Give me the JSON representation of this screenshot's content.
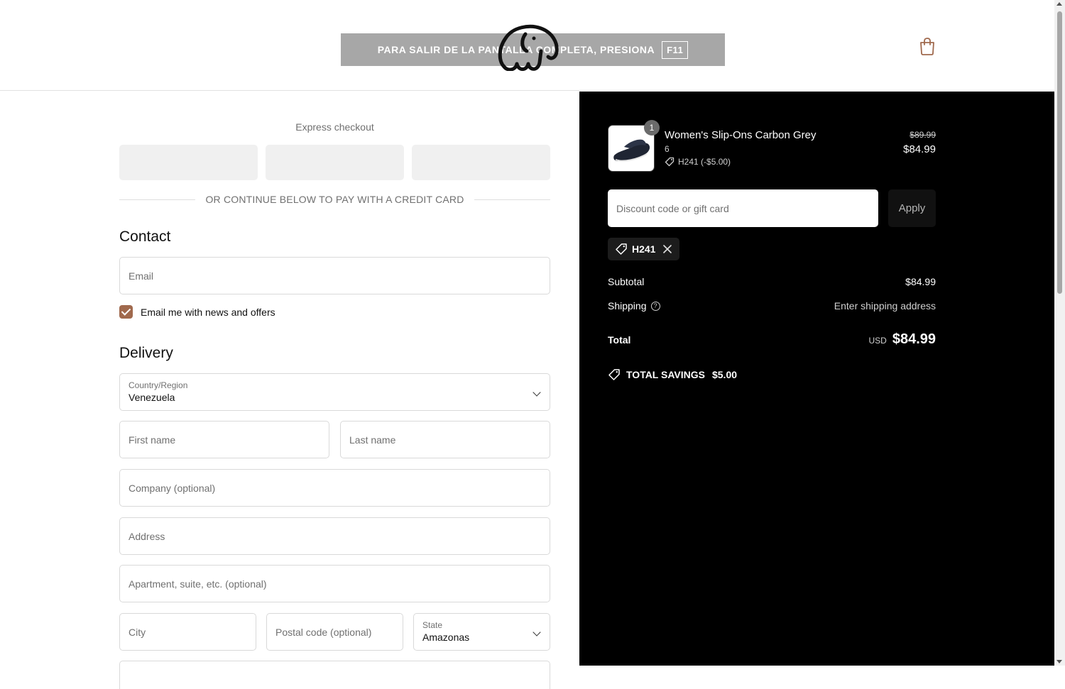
{
  "header": {
    "fullscreen_notice": "PARA SALIR DE LA PANTALLA COMPLETA, PRESIONA",
    "fullscreen_key": "F11",
    "logo_icon": "elephant-logo-icon",
    "cart_icon": "shopping-bag-icon"
  },
  "express": {
    "title": "Express checkout",
    "divider_text": "OR CONTINUE BELOW TO PAY WITH A CREDIT CARD"
  },
  "contact": {
    "title": "Contact",
    "email_placeholder": "Email",
    "newsletter_label": "Email me with news and offers",
    "newsletter_checked": true
  },
  "delivery": {
    "title": "Delivery",
    "country_label": "Country/Region",
    "country_value": "Venezuela",
    "first_name_placeholder": "First name",
    "last_name_placeholder": "Last name",
    "company_placeholder": "Company (optional)",
    "address_placeholder": "Address",
    "apartment_placeholder": "Apartment, suite, etc. (optional)",
    "city_placeholder": "City",
    "postal_placeholder": "Postal code (optional)",
    "state_label": "State",
    "state_value": "Amazonas"
  },
  "summary": {
    "product": {
      "quantity": "1",
      "name": "Women's Slip-Ons Carbon Grey",
      "variant": "6",
      "discount": "H241 (-$5.00)",
      "original_price": "$89.99",
      "price": "$84.99"
    },
    "discount_placeholder": "Discount code or gift card",
    "apply_label": "Apply",
    "applied_code": "H241",
    "subtotal_label": "Subtotal",
    "subtotal_value": "$84.99",
    "shipping_label": "Shipping",
    "shipping_value": "Enter shipping address",
    "total_label": "Total",
    "total_currency": "USD",
    "total_value": "$84.99",
    "savings_label": "TOTAL SAVINGS",
    "savings_value": "$5.00"
  },
  "colors": {
    "accent": "#a0694d",
    "summary_bg": "#000000"
  }
}
